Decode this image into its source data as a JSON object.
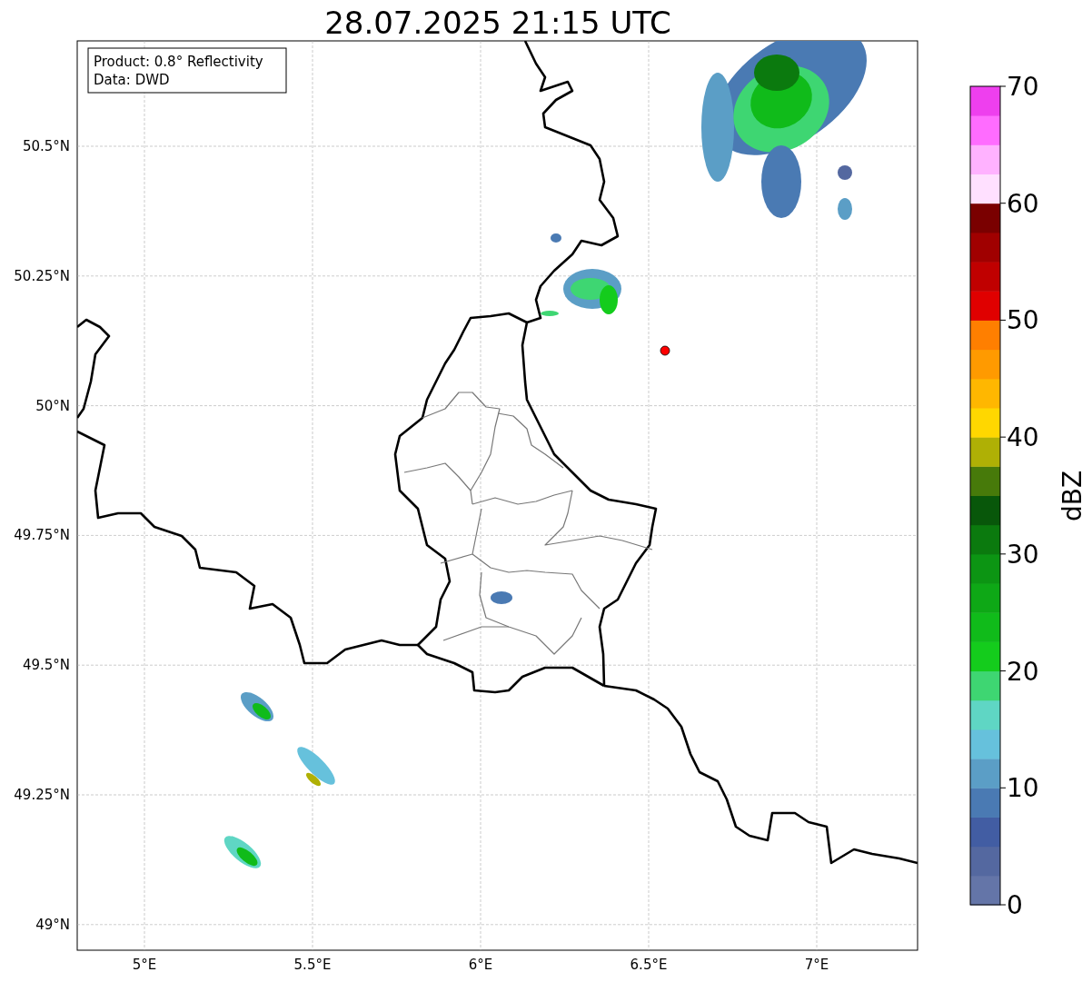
{
  "title": "28.07.2025 21:15 UTC",
  "info_box": [
    "Product: 0.8° Reflectivity",
    "Data: DWD"
  ],
  "map": {
    "lat_labels": [
      "50.5°N",
      "50.25°N",
      "50°N",
      "49.75°N",
      "49.5°N",
      "49.25°N",
      "49°N"
    ],
    "lon_labels": [
      "5°E",
      "5.5°E",
      "6°E",
      "6.5°E",
      "7°E"
    ]
  },
  "colorbar": {
    "label": "dBZ",
    "ticks": [
      "70",
      "60",
      "50",
      "40",
      "30",
      "20",
      "10",
      "0"
    ],
    "bands": [
      {
        "color": "#6475a8"
      },
      {
        "color": "#5468a0"
      },
      {
        "color": "#425da3"
      },
      {
        "color": "#4a7ab3"
      },
      {
        "color": "#5b9ec6"
      },
      {
        "color": "#66c1dc"
      },
      {
        "color": "#5fd6c4"
      },
      {
        "color": "#3ed672"
      },
      {
        "color": "#14cc1c"
      },
      {
        "color": "#10bb1a"
      },
      {
        "color": "#0ea816"
      },
      {
        "color": "#0c9513"
      },
      {
        "color": "#0b7a0e"
      },
      {
        "color": "#08570a"
      },
      {
        "color": "#477a0a"
      },
      {
        "color": "#afb005"
      },
      {
        "color": "#ffd700"
      },
      {
        "color": "#ffb700"
      },
      {
        "color": "#ff9a00"
      },
      {
        "color": "#ff7f00"
      },
      {
        "color": "#e00000"
      },
      {
        "color": "#c00000"
      },
      {
        "color": "#a00000"
      },
      {
        "color": "#7a0000"
      },
      {
        "color": "#ffe0ff"
      },
      {
        "color": "#ffb2ff"
      },
      {
        "color": "#ff6cff"
      },
      {
        "color": "#ee3fee"
      }
    ]
  }
}
